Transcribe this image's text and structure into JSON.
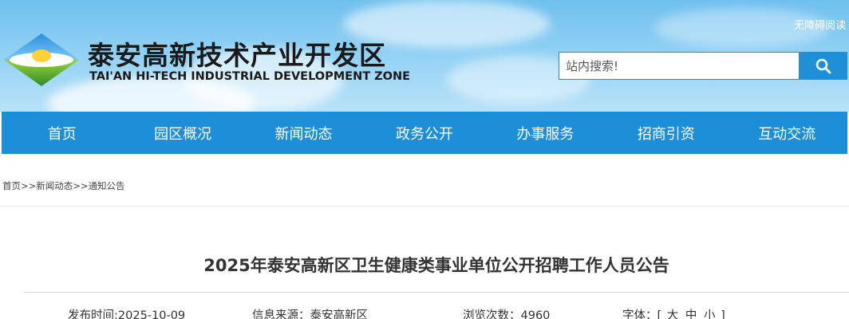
{
  "header": {
    "logo_text_cn": "泰安高新技术产业开发区",
    "logo_text_en": "TAI'AN HI-TECH INDUSTRIAL DEVELOPMENT ZONE",
    "accessible_link": "无障碍阅读",
    "search_placeholder": "站内搜索!",
    "brand_color": "#1c8fd8"
  },
  "nav": {
    "items": [
      {
        "label": "首页"
      },
      {
        "label": "园区概况"
      },
      {
        "label": "新闻动态"
      },
      {
        "label": "政务公开"
      },
      {
        "label": "办事服务"
      },
      {
        "label": "招商引资"
      },
      {
        "label": "互动交流"
      }
    ]
  },
  "breadcrumb": {
    "home": "首页",
    "sep": ">>",
    "level1": "新闻动态",
    "level2": "通知公告"
  },
  "article": {
    "title": "2025年泰安高新区卫生健康类事业单位公开招聘工作人员公告",
    "publish_label": "发布时间:",
    "publish_date": "2025-10-09",
    "source_label": "信息来源：",
    "source_value": "泰安高新区",
    "views_label": "浏览次数：",
    "views_value": "4960",
    "font_label": "字体：",
    "font_open": "[",
    "font_large": "大",
    "font_medium": "中",
    "font_small": "小",
    "font_close": "]"
  },
  "icons": {
    "search": "search-icon",
    "logo": "logo-icon"
  }
}
